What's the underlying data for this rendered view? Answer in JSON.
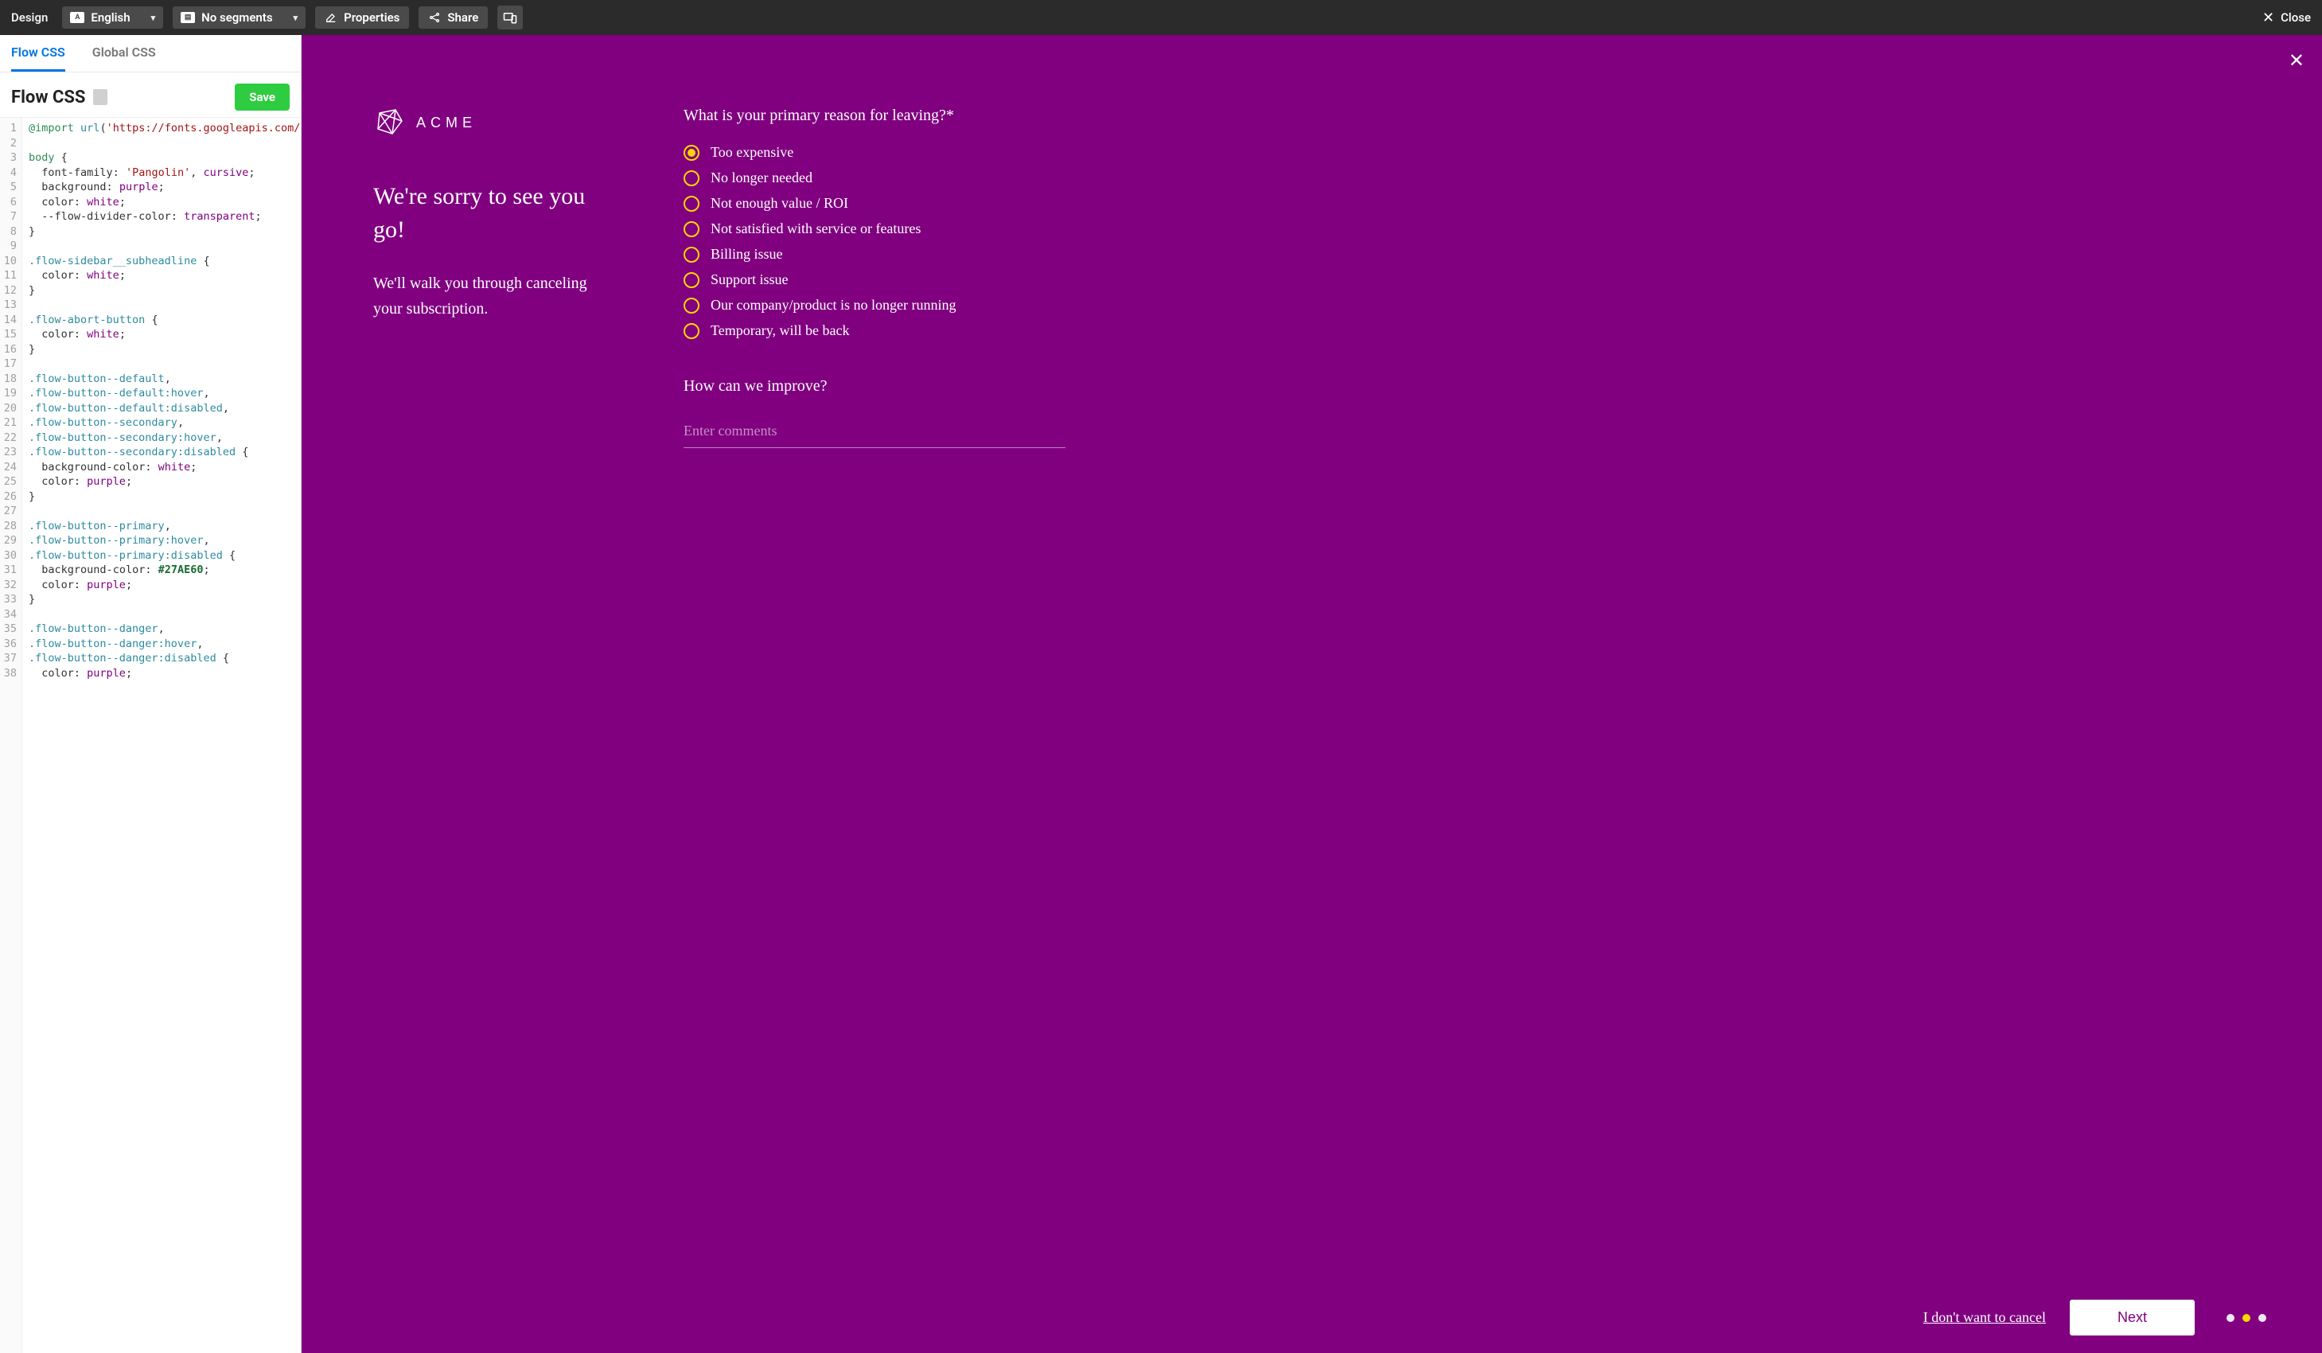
{
  "toolbar": {
    "design_label": "Design",
    "language_dd": "English",
    "segments_dd": "No segments",
    "properties_btn": "Properties",
    "share_btn": "Share",
    "close_btn": "Close"
  },
  "tabs": {
    "flow_css": "Flow CSS",
    "global_css": "Global CSS"
  },
  "panel": {
    "title": "Flow CSS",
    "save_btn": "Save"
  },
  "code_lines": [
    "@import url('https://fonts.googleapis.com/css",
    "",
    "body {",
    "  font-family: 'Pangolin', cursive;",
    "  background: purple;",
    "  color: white;",
    "  --flow-divider-color: transparent;",
    "}",
    "",
    ".flow-sidebar__subheadline {",
    "  color: white;",
    "}",
    "",
    ".flow-abort-button {",
    "  color: white;",
    "}",
    "",
    ".flow-button--default,",
    ".flow-button--default:hover,",
    ".flow-button--default:disabled,",
    ".flow-button--secondary,",
    ".flow-button--secondary:hover,",
    ".flow-button--secondary:disabled {",
    "  background-color: white;",
    "  color: purple;",
    "}",
    "",
    ".flow-button--primary,",
    ".flow-button--primary:hover,",
    ".flow-button--primary:disabled {",
    "  background-color: #27AE60;",
    "  color: purple;",
    "}",
    "",
    ".flow-button--danger,",
    ".flow-button--danger:hover,",
    ".flow-button--danger:disabled {",
    "  color: purple;"
  ],
  "preview": {
    "logo_text": "ACME",
    "headline": "We're sorry to see you go!",
    "subheadline": "We'll walk you through canceling your subscription.",
    "question1": "What is your primary reason for leaving?*",
    "options": [
      "Too expensive",
      "No longer needed",
      "Not enough value / ROI",
      "Not satisfied with service or features",
      "Billing issue",
      "Support issue",
      "Our company/product is no longer running",
      "Temporary, will be back"
    ],
    "selected_option_index": 0,
    "question2": "How can we improve?",
    "comment_placeholder": "Enter comments",
    "cancel_link": "I don't want to cancel",
    "next_btn": "Next",
    "active_dot_index": 1,
    "dot_count": 3
  }
}
